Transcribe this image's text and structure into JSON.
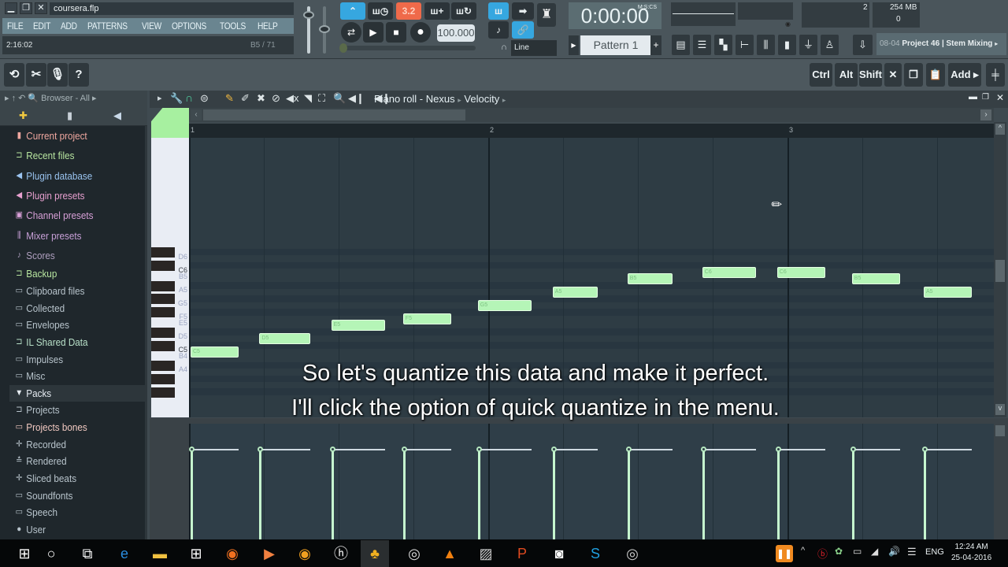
{
  "window": {
    "file_name": "coursera.flp",
    "controls": {
      "minimize": "▁",
      "restore": "❐",
      "close": "✕"
    }
  },
  "menu": [
    "FILE",
    "EDIT",
    "ADD",
    "PATTERNS",
    "VIEW",
    "OPTIONS",
    "TOOLS",
    "HELP"
  ],
  "hint_bar": {
    "time": "2:16:02",
    "position": "B5 / 71"
  },
  "transport": {
    "tempo": "100.000",
    "snap_mode": "Line",
    "countdown_label": "3.2"
  },
  "clock": {
    "value": "0:00:00",
    "unit": "M:S:CS"
  },
  "monitor": {
    "cpu": "2",
    "memory": "254 MB",
    "polyphony": "0"
  },
  "pattern": {
    "name": "Pattern 1",
    "add": "+"
  },
  "news": {
    "date": "08-04",
    "title": "Project 46 | Stem Mixing"
  },
  "shortcut_buttons": [
    "Ctrl",
    "Alt",
    "Shift"
  ],
  "add_button": "Add",
  "browser": {
    "header": "Browser - All",
    "items": [
      {
        "label": "Current project",
        "icon": "project-icon",
        "color": "#f0a8a0"
      },
      {
        "label": "Recent files",
        "icon": "recent-folder-icon",
        "color": "#b8e6a0"
      },
      {
        "label": "Plugin database",
        "icon": "plugin-icon",
        "color": "#9ac4f0"
      },
      {
        "label": "Plugin presets",
        "icon": "plugin-icon",
        "color": "#e8a0d0"
      },
      {
        "label": "Channel presets",
        "icon": "channel-icon",
        "color": "#d8a0d8"
      },
      {
        "label": "Mixer presets",
        "icon": "mixer-icon",
        "color": "#c8a0d8"
      },
      {
        "label": "Scores",
        "icon": "note-icon",
        "color": "#b0a0c0"
      },
      {
        "label": "Backup",
        "icon": "recent-folder-icon",
        "color": "#b8e6a0"
      },
      {
        "label": "Clipboard files",
        "icon": "folder-icon",
        "color": "#b8c4cc"
      },
      {
        "label": "Collected",
        "icon": "folder-icon",
        "color": "#b8c4cc"
      },
      {
        "label": "Envelopes",
        "icon": "folder-icon",
        "color": "#b8c4cc"
      },
      {
        "label": "IL Shared Data",
        "icon": "shared-folder-icon",
        "color": "#b8e0c8"
      },
      {
        "label": "Impulses",
        "icon": "folder-icon",
        "color": "#b8c4cc"
      },
      {
        "label": "Misc",
        "icon": "folder-icon",
        "color": "#b8c4cc"
      },
      {
        "label": "Packs",
        "icon": "packs-icon",
        "color": "#e8eef4"
      },
      {
        "label": "Projects",
        "icon": "shared-folder-icon",
        "color": "#b8c4cc"
      },
      {
        "label": "Projects bones",
        "icon": "folder-icon",
        "color": "#f0c8c0"
      },
      {
        "label": "Recorded",
        "icon": "wave-icon",
        "color": "#b8c4cc"
      },
      {
        "label": "Rendered",
        "icon": "render-icon",
        "color": "#b8c4cc"
      },
      {
        "label": "Sliced beats",
        "icon": "wave-icon",
        "color": "#b8c4cc"
      },
      {
        "label": "Soundfonts",
        "icon": "folder-icon",
        "color": "#b8c4cc"
      },
      {
        "label": "Speech",
        "icon": "folder-icon",
        "color": "#b8c4cc"
      },
      {
        "label": "User",
        "icon": "user-icon",
        "color": "#b8c4cc"
      }
    ],
    "selected": "Packs"
  },
  "piano_roll": {
    "title": "Piano roll - Nexus",
    "target": "Velocity",
    "bars": [
      "1",
      "2",
      "3"
    ],
    "key_labels": [
      "D6",
      "C6",
      "B5",
      "A5",
      "G5",
      "F5",
      "E5",
      "D5",
      "C5",
      "B4",
      "A4"
    ],
    "notes": [
      {
        "pitch": "C5",
        "start": 0.0,
        "length": 0.16
      },
      {
        "pitch": "D5",
        "start": 0.23,
        "length": 0.17
      },
      {
        "pitch": "E5",
        "start": 0.47,
        "length": 0.18
      },
      {
        "pitch": "F5",
        "start": 0.71,
        "length": 0.16
      },
      {
        "pitch": "G5",
        "start": 0.96,
        "length": 0.18
      },
      {
        "pitch": "A5",
        "start": 1.21,
        "length": 0.15
      },
      {
        "pitch": "B5",
        "start": 1.46,
        "length": 0.15
      },
      {
        "pitch": "C6",
        "start": 1.71,
        "length": 0.18
      },
      {
        "pitch": "C6",
        "start": 1.96,
        "length": 0.16
      },
      {
        "pitch": "B5",
        "start": 2.21,
        "length": 0.16
      },
      {
        "pitch": "A5",
        "start": 2.45,
        "length": 0.16
      }
    ],
    "velocity": 0.78
  },
  "subtitle": [
    "So let's quantize this data and make it perfect.",
    "I'll click the option of quick quantize in the menu."
  ],
  "taskbar": {
    "apps": [
      "start-icon",
      "cortana-icon",
      "task-view-icon",
      "edge-icon",
      "explorer-icon",
      "store-icon",
      "firefox-icon",
      "media-icon",
      "chrome-canary-icon",
      "hp-icon",
      "fl-studio-icon",
      "webcam-icon",
      "vlc-icon",
      "app-icon",
      "powerpoint-icon",
      "camera-icon",
      "skype-icon",
      "obs-icon"
    ],
    "language": "ENG",
    "time": "12:24 AM",
    "date": "25-04-2016"
  }
}
